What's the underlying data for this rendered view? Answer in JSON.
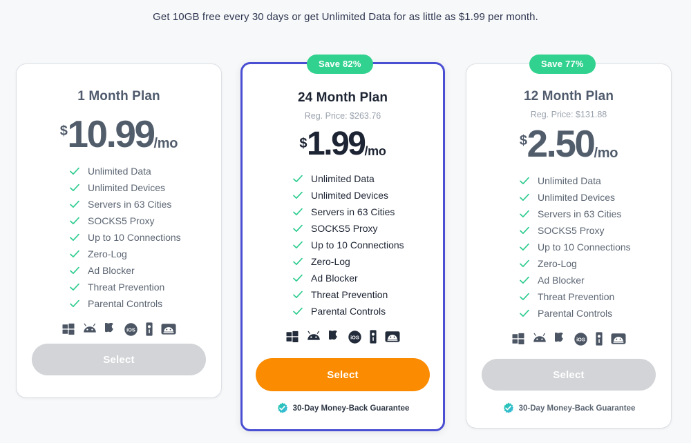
{
  "headline": "Get 10GB free every 30 days or get Unlimited Data for as little as $1.99 per month.",
  "colors": {
    "page_background": "#f7f8f9",
    "card_background": "#ffffff",
    "featured_border": "#4a4ed3",
    "save_badge": "#31d28f",
    "primary_button": "#fb8b00",
    "disabled_button": "#d2d4d7",
    "check_green": "#2ecc8f",
    "guarantee_badge": "#2ec5c5"
  },
  "icons": {
    "check": "check-icon",
    "platforms": [
      "windows-icon",
      "android-icon",
      "apple-icon",
      "ios-icon",
      "firestick-icon",
      "androidtv-icon"
    ],
    "guarantee": "verified-badge-icon"
  },
  "plans": [
    {
      "id": "plan-1-month",
      "title": "1 Month Plan",
      "badge": null,
      "reg_price": null,
      "currency": "$",
      "amount": "10.99",
      "period": "/mo",
      "features": [
        "Unlimited Data",
        "Unlimited Devices",
        "Servers in 63 Cities",
        "SOCKS5 Proxy",
        "Up to 10 Connections",
        "Zero-Log",
        "Ad Blocker",
        "Threat Prevention",
        "Parental Controls"
      ],
      "button_label": "Select",
      "guarantee": null,
      "featured": false
    },
    {
      "id": "plan-24-month",
      "title": "24 Month Plan",
      "badge": "Save 82%",
      "reg_price": "Reg. Price: $263.76",
      "currency": "$",
      "amount": "1.99",
      "period": "/mo",
      "features": [
        "Unlimited Data",
        "Unlimited Devices",
        "Servers in 63 Cities",
        "SOCKS5 Proxy",
        "Up to 10 Connections",
        "Zero-Log",
        "Ad Blocker",
        "Threat Prevention",
        "Parental Controls"
      ],
      "button_label": "Select",
      "guarantee": "30-Day Money-Back Guarantee",
      "featured": true
    },
    {
      "id": "plan-12-month",
      "title": "12 Month Plan",
      "badge": "Save 77%",
      "reg_price": "Reg. Price: $131.88",
      "currency": "$",
      "amount": "2.50",
      "period": "/mo",
      "features": [
        "Unlimited Data",
        "Unlimited Devices",
        "Servers in 63 Cities",
        "SOCKS5 Proxy",
        "Up to 10 Connections",
        "Zero-Log",
        "Ad Blocker",
        "Threat Prevention",
        "Parental Controls"
      ],
      "button_label": "Select",
      "guarantee": "30-Day Money-Back Guarantee",
      "featured": false
    }
  ]
}
